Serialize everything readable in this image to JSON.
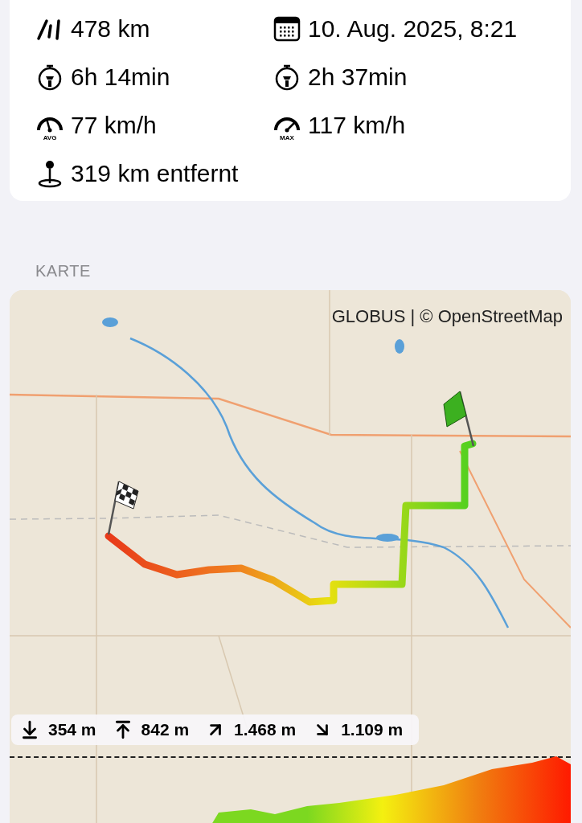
{
  "stats": [
    {
      "kind": "distance",
      "text": "478 km"
    },
    {
      "kind": "date",
      "text": "10. Aug. 2025, 8:21"
    },
    {
      "kind": "duration",
      "text": "6h 14min"
    },
    {
      "kind": "moving",
      "text": "2h 37min"
    },
    {
      "kind": "avg_speed",
      "text": "77 km/h",
      "badge": "AVG"
    },
    {
      "kind": "max_speed",
      "text": "117 km/h",
      "badge": "MAX"
    },
    {
      "kind": "distance_away",
      "text": "319 km entfernt"
    }
  ],
  "map_section": {
    "label": "KARTE",
    "attribution": "GLOBUS | © OpenStreetMap",
    "elevation": [
      {
        "kind": "min",
        "text": "354 m"
      },
      {
        "kind": "max",
        "text": "842 m"
      },
      {
        "kind": "ascent",
        "text": "1.468 m"
      },
      {
        "kind": "descent",
        "text": "1.109 m"
      }
    ]
  }
}
